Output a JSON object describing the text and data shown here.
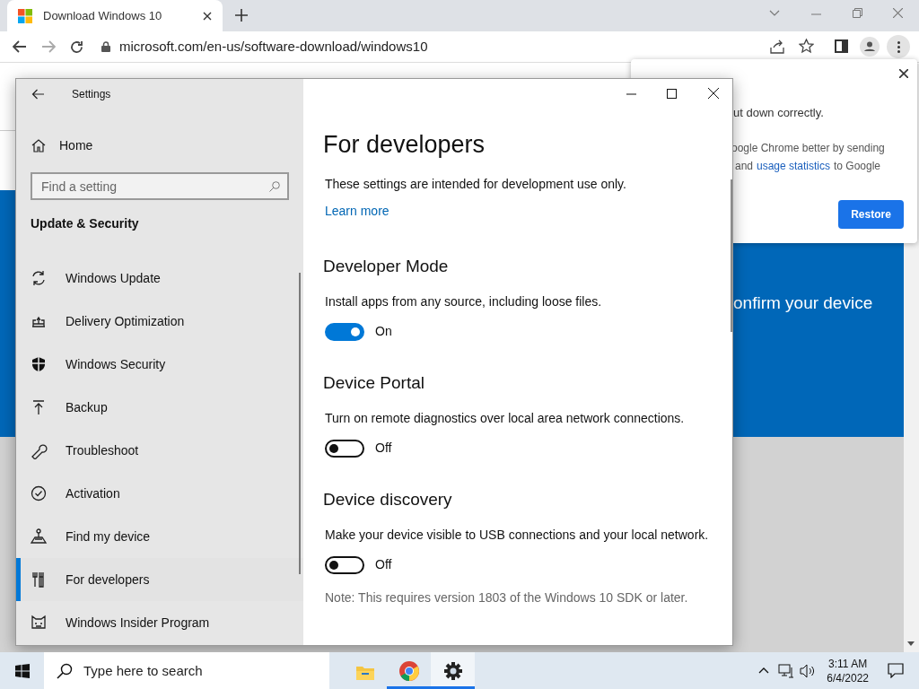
{
  "browser": {
    "tab_title": "Download Windows 10",
    "url": "microsoft.com/en-us/software-download/windows10",
    "page": {
      "banner_text": "onfirm your device"
    },
    "popup": {
      "line_1": "ut down correctly.",
      "line_2": "oogle Chrome better by sending",
      "line_3_before": "and",
      "line_3_link": "usage statistics",
      "line_3_after": "to Google",
      "button": "Restore"
    }
  },
  "settings": {
    "window_title": "Settings",
    "home": "Home",
    "search": {
      "placeholder": "Find a setting"
    },
    "section": "Update & Security",
    "nav_items": [
      {
        "label": "Windows Update",
        "kind": "update",
        "selected": false
      },
      {
        "label": "Delivery Optimization",
        "kind": "delivery",
        "selected": false
      },
      {
        "label": "Windows Security",
        "kind": "shield",
        "selected": false
      },
      {
        "label": "Backup",
        "kind": "backup",
        "selected": false
      },
      {
        "label": "Troubleshoot",
        "kind": "wrench",
        "selected": false
      },
      {
        "label": "Activation",
        "kind": "check",
        "selected": false
      },
      {
        "label": "Find my device",
        "kind": "find",
        "selected": false
      },
      {
        "label": "For developers",
        "kind": "dev",
        "selected": true
      },
      {
        "label": "Windows Insider Program",
        "kind": "insider",
        "selected": false
      }
    ],
    "content": {
      "heading": "For developers",
      "intro": "These settings are intended for development use only.",
      "link": "Learn more",
      "groups": [
        {
          "title": "Developer Mode",
          "description": "Install apps from any source, including loose files.",
          "toggle": {
            "on": true,
            "label": "On"
          }
        },
        {
          "title": "Device Portal",
          "description": "Turn on remote diagnostics over local area network connections.",
          "toggle": {
            "on": false,
            "label": "Off"
          }
        },
        {
          "title": "Device discovery",
          "description": "Make your device visible to USB connections and your local network.",
          "toggle": {
            "on": false,
            "label": "Off"
          },
          "note": "Note: This requires version 1803 of the Windows 10 SDK or later."
        }
      ]
    }
  },
  "taskbar": {
    "search": {
      "placeholder": "Type here to search"
    },
    "apps": [
      {
        "kind": "explorer",
        "running": false,
        "selected": false
      },
      {
        "kind": "chrome",
        "running": true,
        "selected": false
      },
      {
        "kind": "settings",
        "running": true,
        "selected": true
      }
    ],
    "time": "3:11 AM",
    "date": "6/4/2022"
  }
}
